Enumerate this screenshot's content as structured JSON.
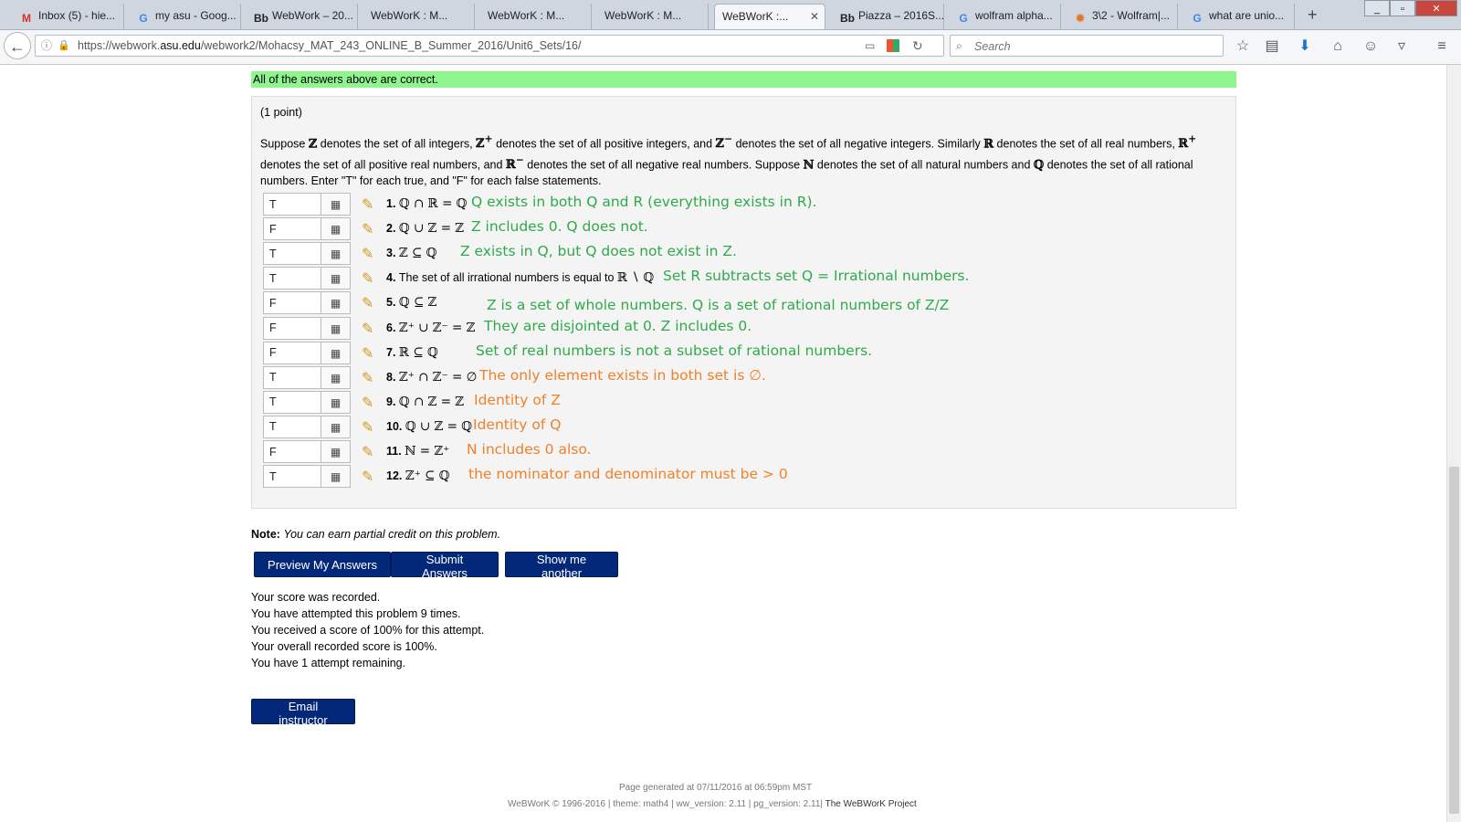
{
  "browser": {
    "tabs": [
      {
        "label": "Inbox (5) - hie...",
        "icon": "gmail-icon",
        "glyph": "M",
        "color": "#d93025"
      },
      {
        "label": "my asu - Goog...",
        "icon": "google-icon",
        "glyph": "G",
        "color": "#4285f4"
      },
      {
        "label": "WebWork – 20...",
        "icon": "blackboard-icon",
        "glyph": "Bb",
        "color": "#222"
      },
      {
        "label": "WebWorK : M...",
        "icon": "",
        "glyph": "",
        "color": "#222"
      },
      {
        "label": "WebWorK : M...",
        "icon": "",
        "glyph": "",
        "color": "#222"
      },
      {
        "label": "WebWorK : M...",
        "icon": "",
        "glyph": "",
        "color": "#222"
      },
      {
        "label": "WeBWorK :...",
        "icon": "",
        "glyph": "",
        "color": "#222",
        "active": true
      },
      {
        "label": "Piazza – 2016S...",
        "icon": "blackboard-icon",
        "glyph": "Bb",
        "color": "#222"
      },
      {
        "label": "wolfram alpha...",
        "icon": "google-icon",
        "glyph": "G",
        "color": "#4285f4"
      },
      {
        "label": "3\\2 - Wolfram|...",
        "icon": "wolfram-icon",
        "glyph": "✹",
        "color": "#e8742b"
      },
      {
        "label": "what are unio...",
        "icon": "google-icon",
        "glyph": "G",
        "color": "#4285f4"
      }
    ],
    "url_prefix": "https://webwork.",
    "url_host": "asu.edu",
    "url_rest": "/webwork2/Mohacsy_MAT_243_ONLINE_B_Summer_2016/Unit6_Sets/16/",
    "search_placeholder": "Search"
  },
  "status": {
    "message": "All of the answers above are correct.",
    "color": "#8ff58f"
  },
  "problem": {
    "points": "(1 point)",
    "statement_html": "Suppose <span class=\"bb\">ℤ</span> denotes the set of all integers, <span class=\"bb\">ℤ<sup>+</sup></span> denotes the set of all positive integers, and <span class=\"bb\">ℤ<sup>−</sup></span> denotes the set of all negative integers. Similarly <span class=\"bb\">ℝ</span> denotes the set of all real numbers, <span class=\"bb\">ℝ<sup>+</sup></span> denotes the set of all positive real numbers, and <span class=\"bb\">ℝ<sup>−</sup></span> denotes the set of all negative real numbers. Suppose <span class=\"bb\">ℕ</span> denotes the set of all natural numbers and <span class=\"bb\">ℚ</span> denotes the set of all rational numbers. Enter \"T\" for each true, and \"F\" for each false statements.",
    "questions": [
      {
        "num": "1.",
        "text": "",
        "math": "ℚ ∩ ℝ = ℚ",
        "answer": "T",
        "note": "Q exists in both Q and R (everything exists in R).",
        "note_color": "green"
      },
      {
        "num": "2.",
        "text": "",
        "math": "ℚ ∪ ℤ = ℤ",
        "answer": "F",
        "note": "Z includes 0. Q does not.",
        "note_color": "green"
      },
      {
        "num": "3.",
        "text": "",
        "math": "ℤ ⊆ ℚ",
        "answer": "T",
        "note": "Z exists in Q, but Q does not exist in Z.",
        "note_color": "green"
      },
      {
        "num": "4.",
        "text": "The set of all irrational numbers is equal to ",
        "math": "ℝ ∖ ℚ",
        "answer": "T",
        "note": "Set R subtracts set Q = Irrational numbers.",
        "note_color": "green"
      },
      {
        "num": "5.",
        "text": "",
        "math": "ℚ ⊆ ℤ",
        "answer": "F",
        "note": "Z is a set of whole numbers. Q is a set of rational numbers of Z/Z",
        "note_color": "green"
      },
      {
        "num": "6.",
        "text": "",
        "math": "ℤ⁺ ∪ ℤ⁻ = ℤ",
        "answer": "F",
        "note": "They are disjointed at 0.  Z includes 0.",
        "note_color": "green"
      },
      {
        "num": "7.",
        "text": "",
        "math": "ℝ ⊆ ℚ",
        "answer": "F",
        "note": "Set of real numbers is not a subset of rational numbers.",
        "note_color": "green"
      },
      {
        "num": "8.",
        "text": "",
        "math": "ℤ⁺ ∩ ℤ⁻ = ∅",
        "answer": "T",
        "note": "The only element exists in both set is ∅.",
        "note_color": "orange"
      },
      {
        "num": "9.",
        "text": "",
        "math": "ℚ ∩ ℤ = ℤ",
        "answer": "T",
        "note": "Identity of Z",
        "note_color": "orange"
      },
      {
        "num": "10.",
        "text": "",
        "math": "ℚ ∪ ℤ = ℚ",
        "answer": "T",
        "note": "Identity of Q",
        "note_color": "orange"
      },
      {
        "num": "11.",
        "text": "",
        "math": "ℕ = ℤ⁺",
        "answer": "F",
        "note": "N includes 0 also.",
        "note_color": "orange"
      },
      {
        "num": "12.",
        "text": "",
        "math": "ℤ⁺ ⊆ ℚ",
        "answer": "T",
        "note": "the nominator and denominator must be > 0",
        "note_color": "orange"
      }
    ]
  },
  "note": {
    "label": "Note:",
    "text": "You can earn partial credit on this problem."
  },
  "buttons": {
    "preview": "Preview My Answers",
    "submit": "Submit Answers",
    "another": "Show me another",
    "email": "Email instructor"
  },
  "score_lines": [
    "Your score was recorded.",
    "You have attempted this problem 9 times.",
    "You received a score of 100% for this attempt.",
    "Your overall recorded score is 100%.",
    "You have 1 attempt remaining."
  ],
  "footer": {
    "generated": "Page generated at 07/11/2016 at 06:59pm MST",
    "copyright": "WeBWorK © 1996-2016 | theme: math4 | ww_version: 2.11 | pg_version: 2.11|",
    "project": "The WeBWorK Project"
  }
}
